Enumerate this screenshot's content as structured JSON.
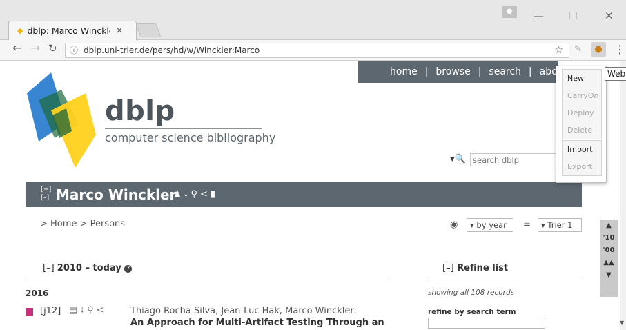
{
  "browser": {
    "tab_title": "dblp: Marco Winckle",
    "tab_close": "×",
    "url": "dblp.uni-trier.de/pers/hd/w/Winckler:Marco",
    "win_min": "—",
    "win_max": "☐",
    "win_close": "✕"
  },
  "nav": {
    "home": "home",
    "browse": "browse",
    "search": "search",
    "about": "about",
    "sep": "|"
  },
  "header": {
    "logo_text": "dblp",
    "subtitle": "computer science bibliography",
    "search_placeholder": "search dblp"
  },
  "person": {
    "expand_plus": "[+]",
    "expand_minus": "[–]",
    "name": "Marco Winckler"
  },
  "breadcrumb": "> Home > Persons",
  "controls": {
    "order": "▾ by year",
    "mirror": "▾ Trier 1"
  },
  "jump": [
    "▲",
    "'10",
    "'00",
    "▲▲",
    "▼"
  ],
  "section": {
    "toggle": "[–]",
    "title": "2010 – today",
    "help": "?"
  },
  "refine": {
    "toggle": "[–]",
    "title": "Refine list",
    "showing": "showing all 108 records",
    "search_label": "refine by search term"
  },
  "publication": {
    "year": "2016",
    "key": "[j12]",
    "authors": "Thiago Rocha Silva, Jean-Luc Hak, Marco Winckler:",
    "title": "An Approach for Multi-Artifact Testing Through an"
  },
  "popup": {
    "items": [
      {
        "label": "New",
        "enabled": true
      },
      {
        "label": "CarryOn",
        "enabled": false
      },
      {
        "label": "Deploy",
        "enabled": false
      },
      {
        "label": "Delete",
        "enabled": false
      },
      {
        "label": "Import",
        "enabled": true
      },
      {
        "label": "Export",
        "enabled": false
      }
    ],
    "tooltip": "Web"
  },
  "colors": {
    "navbar": "#5d6770",
    "marker": "#c7317b"
  }
}
